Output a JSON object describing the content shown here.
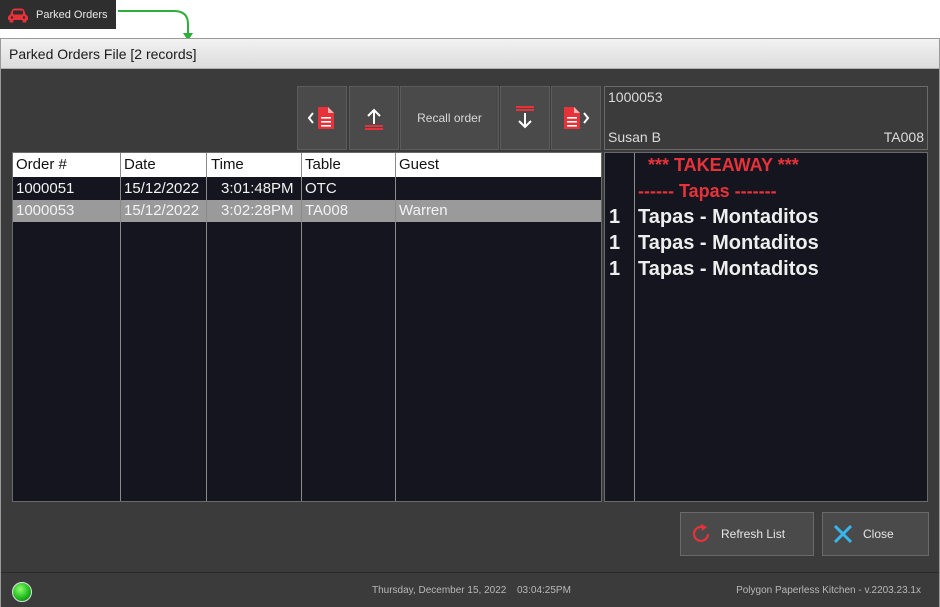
{
  "tab": {
    "label": "Parked Orders",
    "icon": "car-icon"
  },
  "window": {
    "title": "Parked Orders File [2 records]"
  },
  "toolbar": {
    "recall_label": "Recall order"
  },
  "order_header": {
    "order_number": "1000053",
    "waiter": "Susan B",
    "table": "TA008"
  },
  "orders_table": {
    "columns": [
      "Order #",
      "Date",
      "Time",
      "Table",
      "Guest"
    ],
    "rows": [
      {
        "order": "1000051",
        "date": "15/12/2022",
        "time": "3:01:48PM",
        "table": "OTC",
        "guest": ""
      },
      {
        "order": "1000053",
        "date": "15/12/2022",
        "time": "3:02:28PM",
        "table": "TA008",
        "guest": "Warren"
      }
    ],
    "selected_index": 1
  },
  "docket": {
    "heading": "*** TAKEAWAY ***",
    "section": "------ Tapas -------",
    "items": [
      {
        "qty": "1",
        "name": "Tapas - Montaditos"
      },
      {
        "qty": "1",
        "name": "Tapas - Montaditos"
      },
      {
        "qty": "1",
        "name": "Tapas - Montaditos"
      }
    ]
  },
  "buttons": {
    "refresh_label": "Refresh List",
    "close_label": "Close"
  },
  "status": {
    "date": "Thursday, December 15, 2022",
    "time": "03:04:25PM",
    "version": "Polygon Paperless Kitchen - v.2203.23.1x",
    "connection_color": "#19b51b"
  },
  "colors": {
    "accent_red": "#e8323a",
    "selected_row": "#9a9a9a",
    "panel_bg": "#3b3b3b",
    "list_bg": "#15151f"
  }
}
